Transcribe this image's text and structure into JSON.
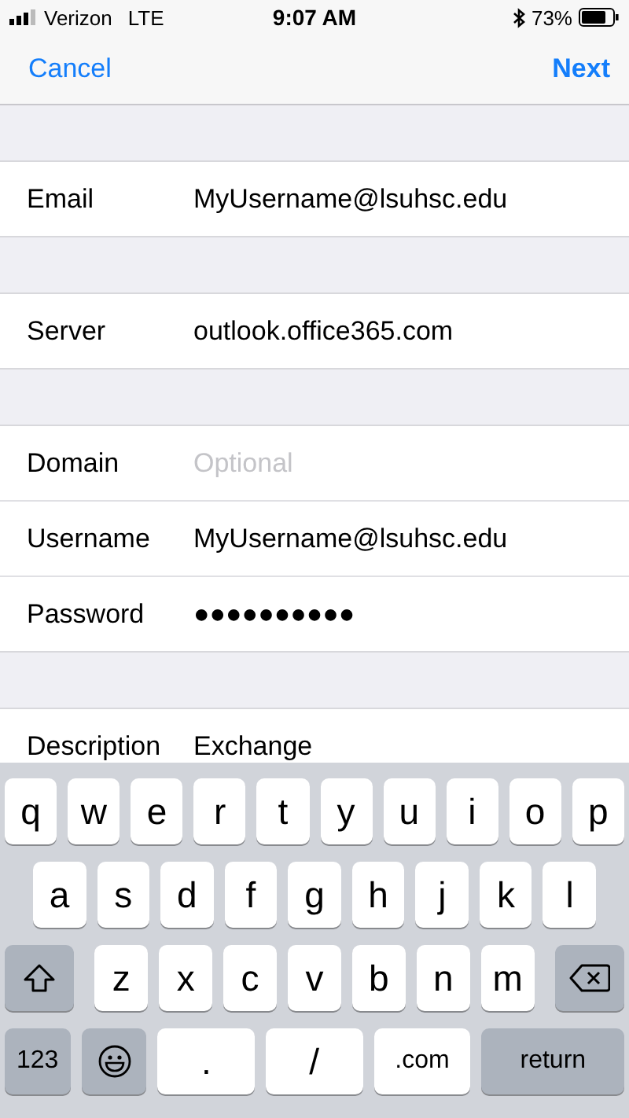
{
  "status_bar": {
    "carrier": "Verizon",
    "network": "LTE",
    "time": "9:07 AM",
    "battery": "73%"
  },
  "nav": {
    "cancel": "Cancel",
    "next": "Next"
  },
  "sections": [
    {
      "rows": [
        {
          "label": "Email",
          "value": "MyUsername@lsuhsc.edu"
        }
      ]
    },
    {
      "rows": [
        {
          "label": "Server",
          "value": "outlook.office365.com"
        }
      ]
    },
    {
      "rows": [
        {
          "label": "Domain",
          "placeholder": "Optional"
        },
        {
          "label": "Username",
          "value": "MyUsername@lsuhsc.edu"
        },
        {
          "label": "Password",
          "value": "●●●●●●●●●●"
        }
      ]
    },
    {
      "rows": [
        {
          "label": "Description",
          "value": "Exchange"
        }
      ]
    }
  ],
  "keyboard": {
    "rows": [
      {
        "keys": [
          {
            "kind": "letter",
            "label": "q"
          },
          {
            "kind": "letter",
            "label": "w"
          },
          {
            "kind": "letter",
            "label": "e"
          },
          {
            "kind": "letter",
            "label": "r"
          },
          {
            "kind": "letter",
            "label": "t"
          },
          {
            "kind": "letter",
            "label": "y"
          },
          {
            "kind": "letter",
            "label": "u"
          },
          {
            "kind": "letter",
            "label": "i"
          },
          {
            "kind": "letter",
            "label": "o"
          },
          {
            "kind": "letter",
            "label": "p"
          }
        ]
      },
      {
        "keys": [
          {
            "kind": "letter",
            "label": "a"
          },
          {
            "kind": "letter",
            "label": "s"
          },
          {
            "kind": "letter",
            "label": "d"
          },
          {
            "kind": "letter",
            "label": "f"
          },
          {
            "kind": "letter",
            "label": "g"
          },
          {
            "kind": "letter",
            "label": "h"
          },
          {
            "kind": "letter",
            "label": "j"
          },
          {
            "kind": "letter",
            "label": "k"
          },
          {
            "kind": "letter",
            "label": "l"
          }
        ]
      },
      {
        "keys": [
          {
            "kind": "shift"
          },
          {
            "kind": "letter",
            "label": "z"
          },
          {
            "kind": "letter",
            "label": "x"
          },
          {
            "kind": "letter",
            "label": "c"
          },
          {
            "kind": "letter",
            "label": "v"
          },
          {
            "kind": "letter",
            "label": "b"
          },
          {
            "kind": "letter",
            "label": "n"
          },
          {
            "kind": "letter",
            "label": "m"
          },
          {
            "kind": "delete"
          }
        ]
      },
      {
        "keys": [
          {
            "kind": "mode",
            "label": "123"
          },
          {
            "kind": "emoji"
          },
          {
            "kind": "symbol",
            "label": "."
          },
          {
            "kind": "symbol",
            "label": "/"
          },
          {
            "kind": "symbol",
            "label": ".com"
          },
          {
            "kind": "return",
            "label": "return"
          }
        ]
      }
    ]
  }
}
